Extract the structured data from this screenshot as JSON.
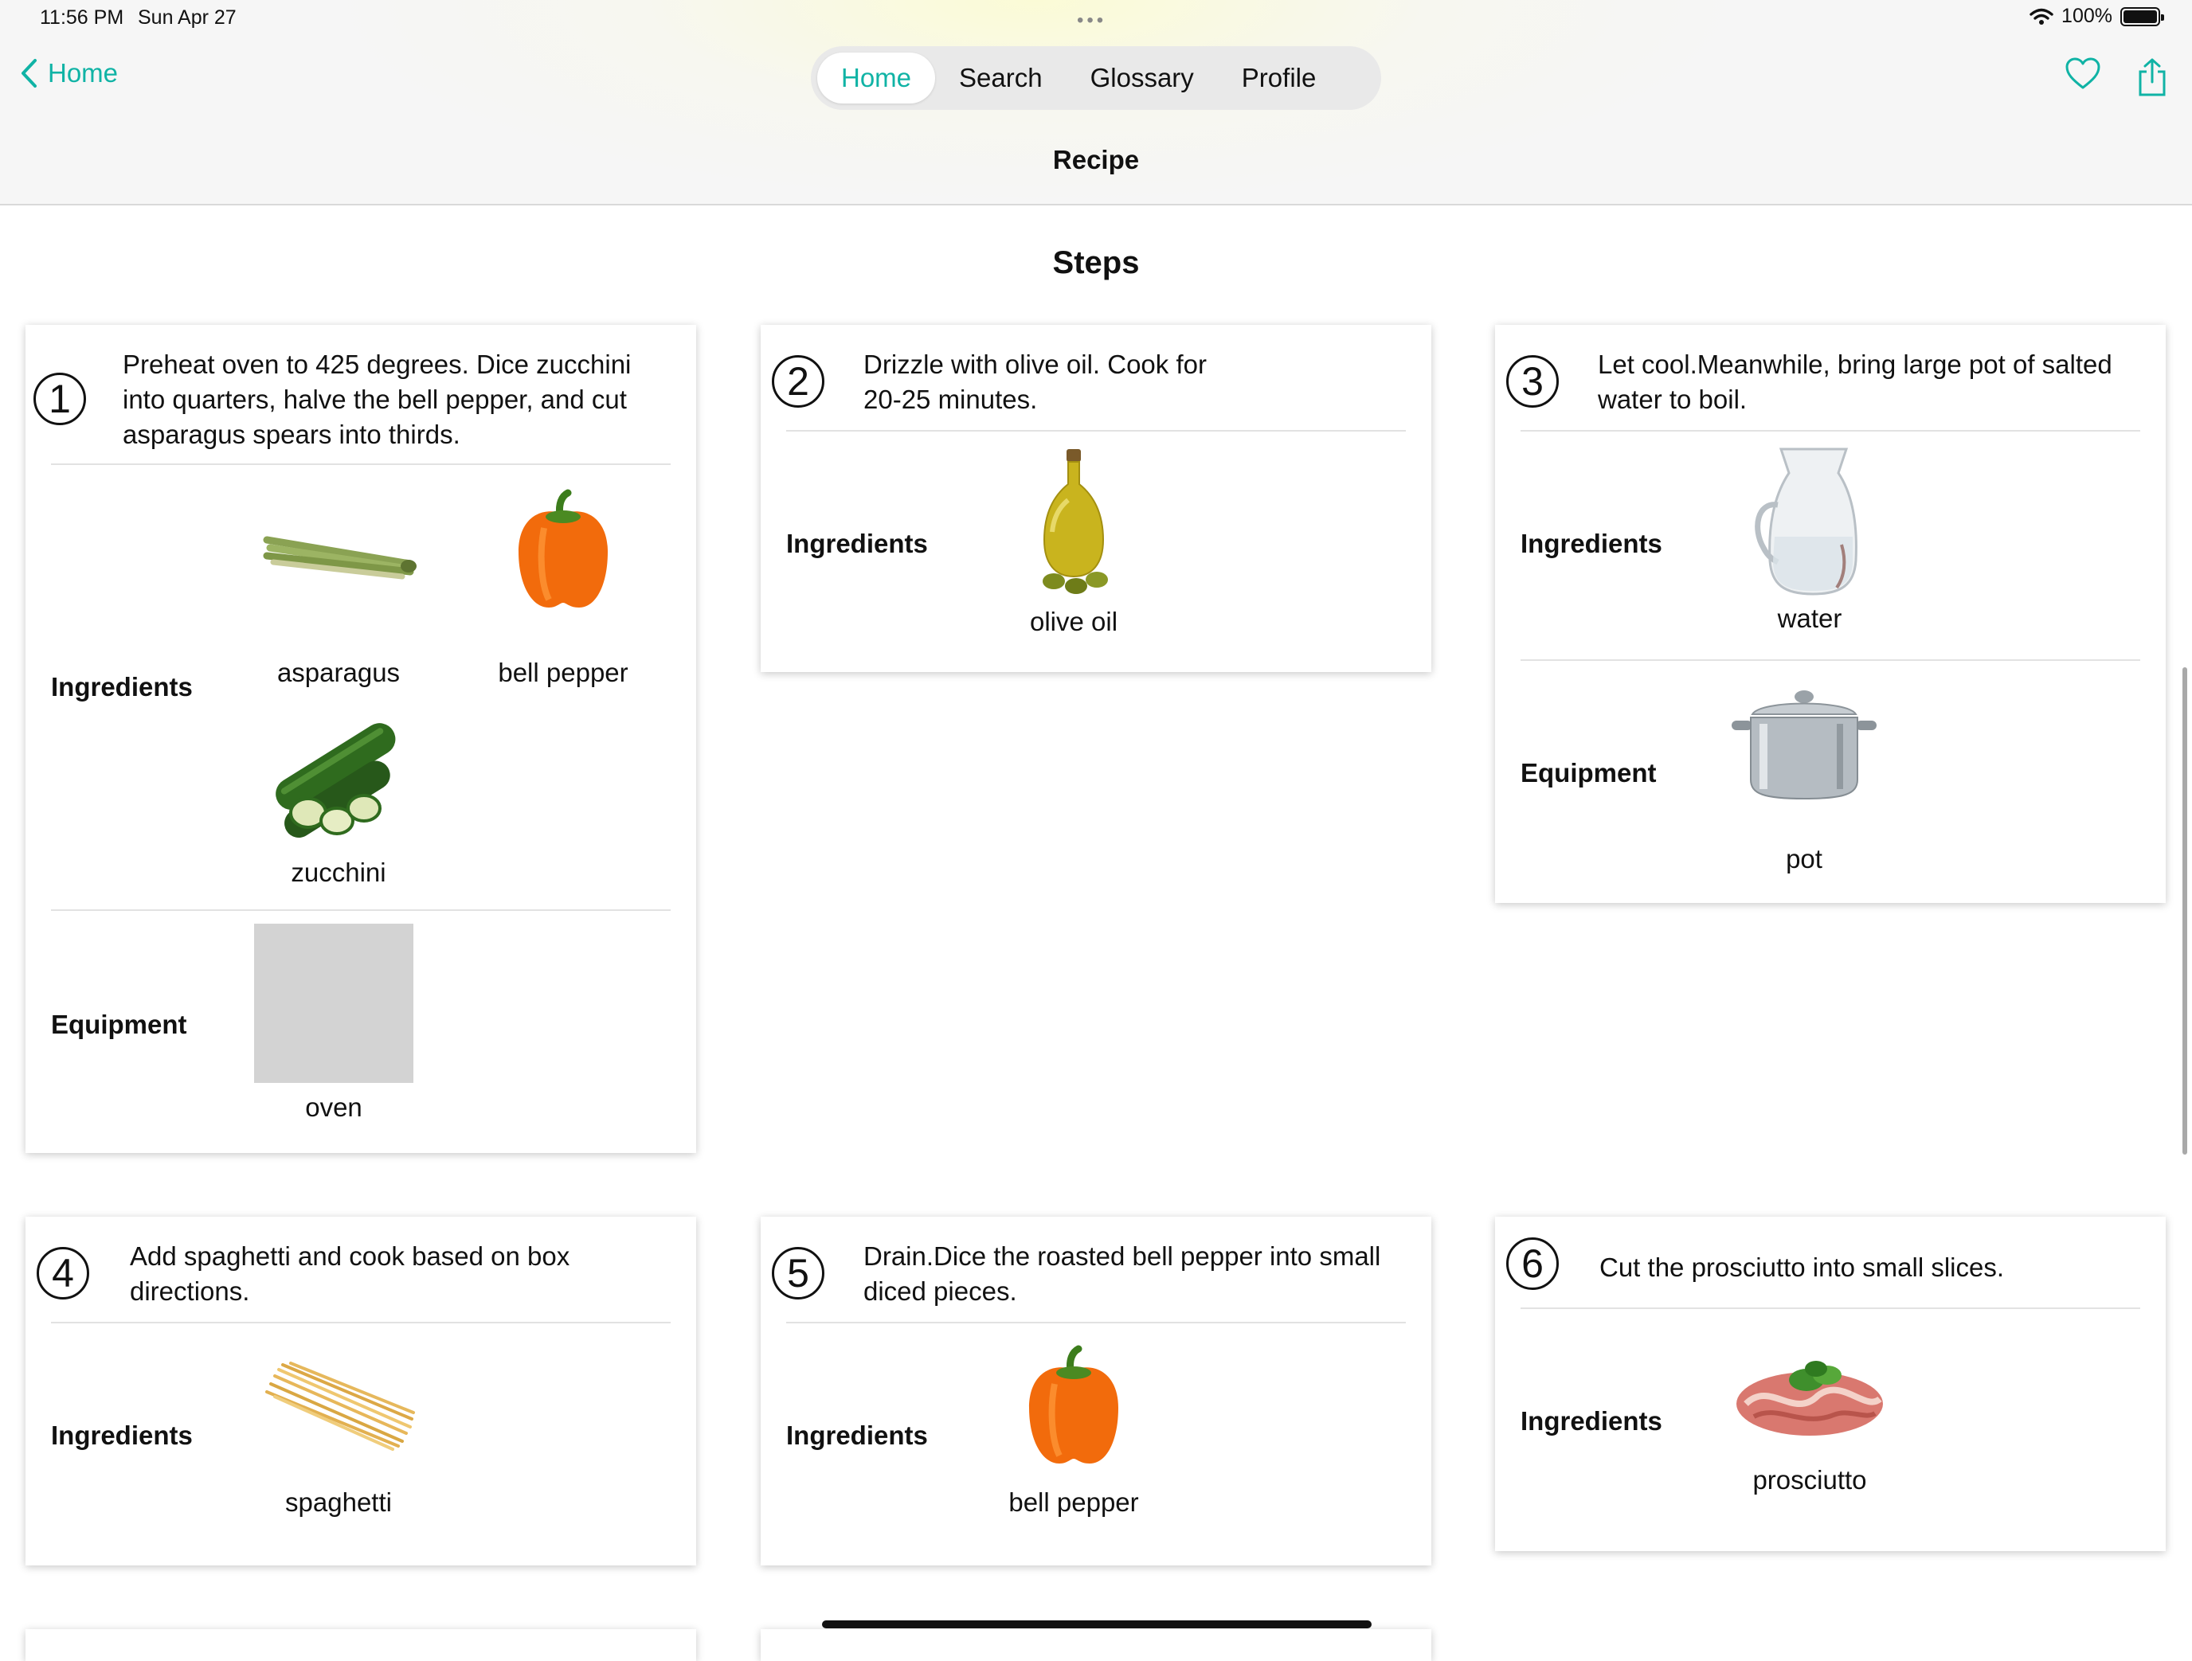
{
  "status": {
    "time": "11:56 PM",
    "date": "Sun Apr 27",
    "battery": "100%"
  },
  "nav": {
    "back_label": "Home",
    "tabs": [
      {
        "label": "Home",
        "active": true
      },
      {
        "label": "Search",
        "active": false
      },
      {
        "label": "Glossary",
        "active": false
      },
      {
        "label": "Profile",
        "active": false
      }
    ],
    "title": "Recipe",
    "icons": [
      "heart-icon",
      "share-icon"
    ]
  },
  "steps_heading": "Steps",
  "section_labels": {
    "ingredients": "Ingredients",
    "equipment": "Equipment"
  },
  "steps": [
    {
      "number": "1",
      "text": "Preheat oven to 425 degrees. Dice zucchini into quarters, halve the bell pepper, and cut asparagus spears into thirds.",
      "ingredients": [
        "asparagus",
        "bell pepper",
        "zucchini"
      ],
      "equipment": [
        "oven"
      ]
    },
    {
      "number": "2",
      "text": "Drizzle with olive oil. Cook for 20-25 minutes.",
      "ingredients": [
        "olive oil"
      ],
      "equipment": []
    },
    {
      "number": "3",
      "text": "Let cool.Meanwhile, bring large pot of salted water to boil.",
      "ingredients": [
        "water"
      ],
      "equipment": [
        "pot"
      ]
    },
    {
      "number": "4",
      "text": "Add spaghetti and cook based on box directions.",
      "ingredients": [
        "spaghetti"
      ],
      "equipment": []
    },
    {
      "number": "5",
      "text": "Drain.Dice the roasted bell pepper into small diced pieces.",
      "ingredients": [
        "bell pepper"
      ],
      "equipment": []
    },
    {
      "number": "6",
      "text": "Cut the prosciutto into small slices.",
      "ingredients": [
        "prosciutto"
      ],
      "equipment": []
    }
  ],
  "colors": {
    "accent": "#10b3a5",
    "segment_bg": "#e9e9e9",
    "placeholder_image": "#d3d3d3"
  }
}
